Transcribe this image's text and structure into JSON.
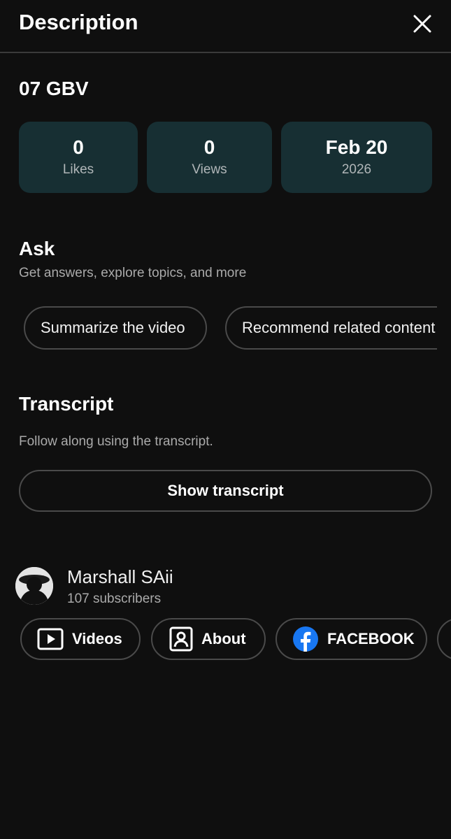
{
  "header": {
    "title": "Description",
    "close_icon": "close-icon"
  },
  "video": {
    "title": "07 GBV"
  },
  "stats": {
    "likes_value": "0",
    "likes_label": "Likes",
    "views_value": "0",
    "views_label": "Views",
    "date_value": "Feb 20",
    "date_label": "2026"
  },
  "ask": {
    "title": "Ask",
    "subtitle": "Get answers, explore topics, and more",
    "chips": [
      "Summarize the video",
      "Recommend related content"
    ]
  },
  "transcript": {
    "title": "Transcript",
    "subtitle": "Follow along using the transcript.",
    "button_label": "Show transcript"
  },
  "channel": {
    "name": "Marshall SAii",
    "subscribers": "107 subscribers",
    "links": [
      {
        "label": "Videos",
        "icon": "play-box-icon"
      },
      {
        "label": "About",
        "icon": "person-box-icon"
      },
      {
        "label": "FACEBOOK",
        "icon": "facebook-icon"
      }
    ]
  },
  "colors": {
    "background": "#0f0f0f",
    "stat_card": "#172f33",
    "facebook_blue": "#1877f2"
  }
}
